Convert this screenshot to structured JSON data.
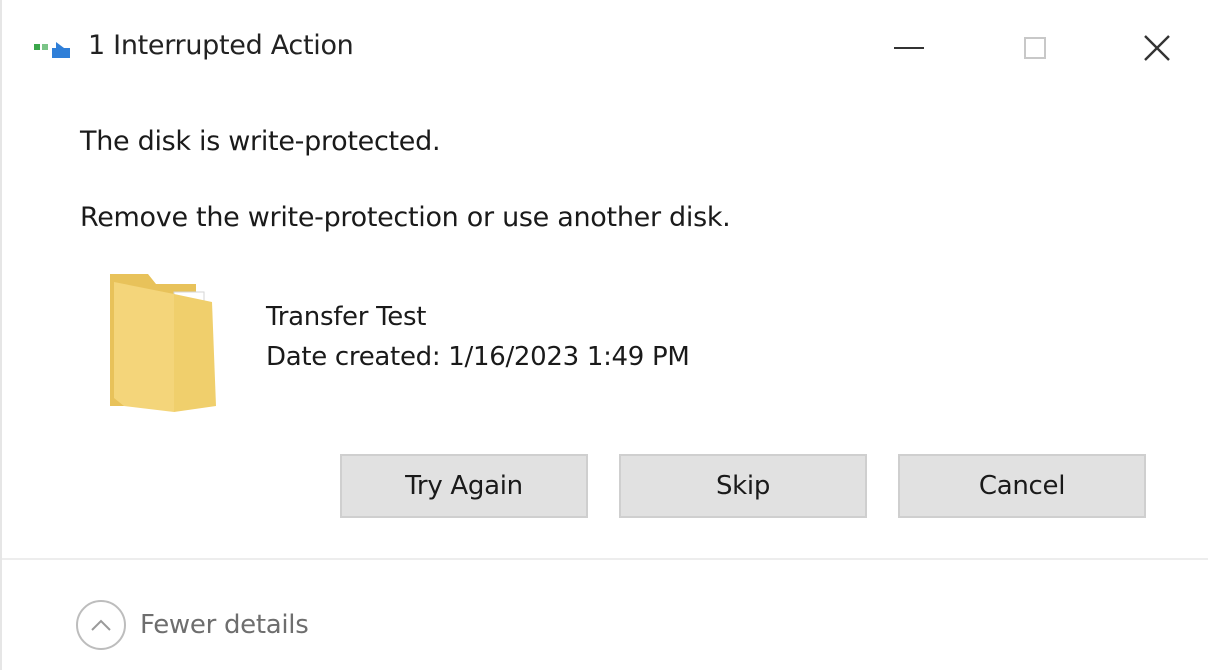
{
  "window": {
    "title": "1 Interrupted Action",
    "icon": "file-move-icon"
  },
  "caption": {
    "minimize_icon": "minimize-icon",
    "maximize_icon": "maximize-icon",
    "close_icon": "close-icon"
  },
  "message": {
    "main": "The disk is write-protected.",
    "sub": "Remove the write-protection or use another disk."
  },
  "file": {
    "icon": "folder-icon",
    "name": "Transfer Test",
    "date_created": "Date created: 1/16/2023 1:49 PM"
  },
  "buttons": {
    "try_again": "Try Again",
    "skip": "Skip",
    "cancel": "Cancel"
  },
  "footer": {
    "toggle_label": "Fewer details",
    "toggle_icon": "chevron-up-icon"
  },
  "colors": {
    "button_bg": "#e1e1e1",
    "button_border": "#cfcfcf",
    "folder_yellow": "#f4d57a",
    "icon_green": "#3aa64a",
    "icon_blue": "#2f7fd8"
  }
}
